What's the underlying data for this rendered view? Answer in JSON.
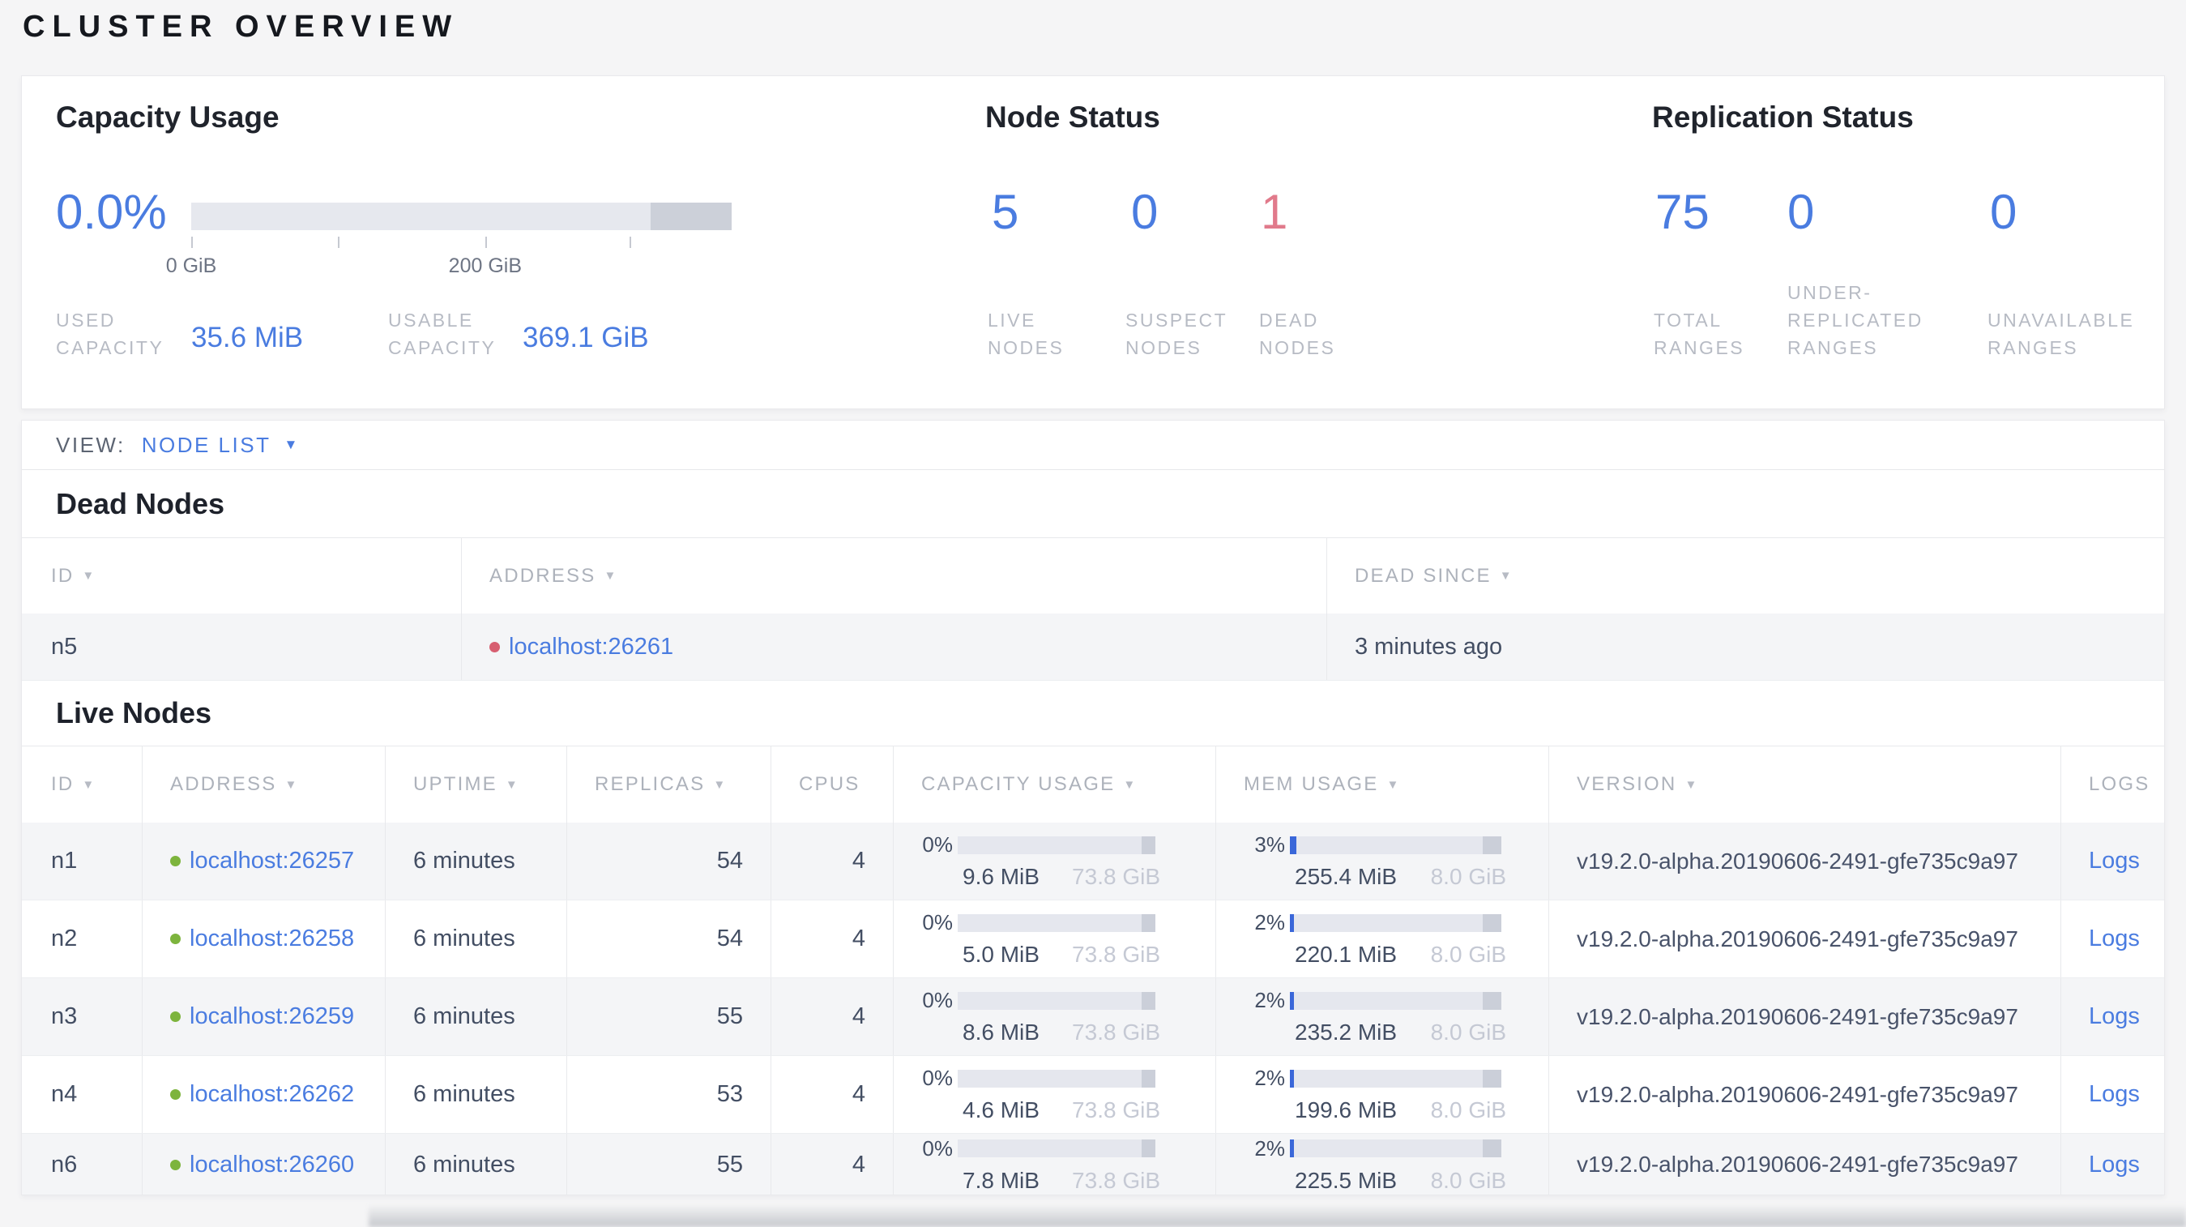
{
  "page": {
    "title": "CLUSTER OVERVIEW"
  },
  "colors": {
    "accent_blue": "#4a7ce0",
    "bar_fill_blue": "#3a67d9",
    "danger_red": "#e17a8b",
    "live_dot_green": "#7db43d",
    "dead_dot_red": "#d75f71"
  },
  "summary": {
    "capacity": {
      "title": "Capacity Usage",
      "percent": "0.0%",
      "bar": {
        "reserve_pct": 15,
        "tick_positions_pct": [
          0,
          27.1,
          54.4,
          81.1
        ],
        "tick_labels": [
          "0 GiB",
          "200 GiB"
        ],
        "tick_label_positions_pct": [
          0,
          54.4
        ]
      },
      "stats": [
        {
          "label": "USED CAPACITY",
          "value": "35.6 MiB"
        },
        {
          "label": "USABLE CAPACITY",
          "value": "369.1 GiB"
        }
      ]
    },
    "node_status": {
      "title": "Node Status",
      "stats": [
        {
          "value": "5",
          "label": "LIVE NODES"
        },
        {
          "value": "0",
          "label": "SUSPECT NODES"
        },
        {
          "value": "1",
          "label": "DEAD NODES"
        }
      ]
    },
    "replication": {
      "title": "Replication Status",
      "stats": [
        {
          "value": "75",
          "label": "TOTAL RANGES"
        },
        {
          "value": "0",
          "label": "UNDER-REPLICATED RANGES"
        },
        {
          "value": "0",
          "label": "UNAVAILABLE RANGES"
        }
      ]
    }
  },
  "view_bar": {
    "label": "VIEW:",
    "selected": "NODE LIST"
  },
  "dead_nodes": {
    "heading": "Dead Nodes",
    "columns": [
      {
        "label": "ID"
      },
      {
        "label": "ADDRESS"
      },
      {
        "label": "DEAD SINCE"
      }
    ],
    "rows": [
      {
        "id": "n5",
        "address": "localhost:26261",
        "dead_since": "3 minutes ago"
      }
    ]
  },
  "live_nodes": {
    "heading": "Live Nodes",
    "logs_label": "Logs",
    "columns": [
      {
        "label": "ID"
      },
      {
        "label": "ADDRESS"
      },
      {
        "label": "UPTIME"
      },
      {
        "label": "REPLICAS"
      },
      {
        "label": "CPUS"
      },
      {
        "label": "CAPACITY USAGE"
      },
      {
        "label": "MEM USAGE"
      },
      {
        "label": "VERSION"
      },
      {
        "label": "LOGS"
      }
    ],
    "rows": [
      {
        "id": "n1",
        "address": "localhost:26257",
        "uptime": "6 minutes",
        "replicas": "54",
        "cpus": "4",
        "capacity": {
          "pct": "0%",
          "used": "9.6 MiB",
          "total": "73.8 GiB",
          "fill_pct": 0,
          "reserve_pct": 7
        },
        "memory": {
          "pct": "3%",
          "used": "255.4 MiB",
          "total": "8.0 GiB",
          "fill_pct": 3,
          "reserve_pct": 9
        },
        "version": "v19.2.0-alpha.20190606-2491-gfe735c9a97"
      },
      {
        "id": "n2",
        "address": "localhost:26258",
        "uptime": "6 minutes",
        "replicas": "54",
        "cpus": "4",
        "capacity": {
          "pct": "0%",
          "used": "5.0 MiB",
          "total": "73.8 GiB",
          "fill_pct": 0,
          "reserve_pct": 7
        },
        "memory": {
          "pct": "2%",
          "used": "220.1 MiB",
          "total": "8.0 GiB",
          "fill_pct": 2,
          "reserve_pct": 9
        },
        "version": "v19.2.0-alpha.20190606-2491-gfe735c9a97"
      },
      {
        "id": "n3",
        "address": "localhost:26259",
        "uptime": "6 minutes",
        "replicas": "55",
        "cpus": "4",
        "capacity": {
          "pct": "0%",
          "used": "8.6 MiB",
          "total": "73.8 GiB",
          "fill_pct": 0,
          "reserve_pct": 7
        },
        "memory": {
          "pct": "2%",
          "used": "235.2 MiB",
          "total": "8.0 GiB",
          "fill_pct": 2,
          "reserve_pct": 9
        },
        "version": "v19.2.0-alpha.20190606-2491-gfe735c9a97"
      },
      {
        "id": "n4",
        "address": "localhost:26262",
        "uptime": "6 minutes",
        "replicas": "53",
        "cpus": "4",
        "capacity": {
          "pct": "0%",
          "used": "4.6 MiB",
          "total": "73.8 GiB",
          "fill_pct": 0,
          "reserve_pct": 7
        },
        "memory": {
          "pct": "2%",
          "used": "199.6 MiB",
          "total": "8.0 GiB",
          "fill_pct": 2,
          "reserve_pct": 9
        },
        "version": "v19.2.0-alpha.20190606-2491-gfe735c9a97"
      },
      {
        "id": "n6",
        "address": "localhost:26260",
        "uptime": "6 minutes",
        "replicas": "55",
        "cpus": "4",
        "capacity": {
          "pct": "0%",
          "used": "7.8 MiB",
          "total": "73.8 GiB",
          "fill_pct": 0,
          "reserve_pct": 7
        },
        "memory": {
          "pct": "2%",
          "used": "225.5 MiB",
          "total": "8.0 GiB",
          "fill_pct": 2,
          "reserve_pct": 9
        },
        "version": "v19.2.0-alpha.20190606-2491-gfe735c9a97"
      }
    ]
  }
}
